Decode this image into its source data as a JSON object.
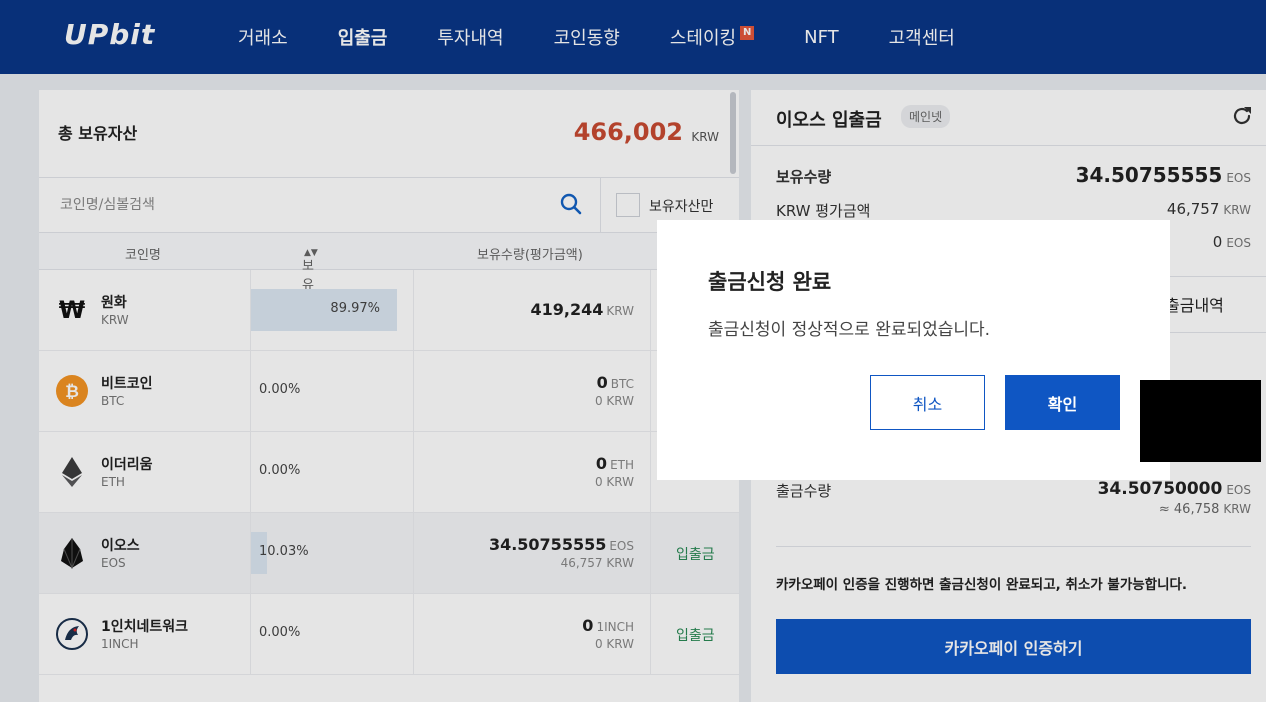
{
  "header": {
    "logo": "UPbit",
    "nav": [
      {
        "label": "거래소"
      },
      {
        "label": "입출금"
      },
      {
        "label": "투자내역"
      },
      {
        "label": "코인동향"
      },
      {
        "label": "스테이킹",
        "badge": "N"
      },
      {
        "label": "NFT"
      },
      {
        "label": "고객센터"
      }
    ],
    "active_nav": "입출금"
  },
  "assets": {
    "total_label": "총 보유자산",
    "total_value": "466,002",
    "total_unit": "KRW",
    "search_placeholder": "코인명/심볼검색",
    "own_only_label": "보유자산만",
    "columns": {
      "name": "코인명",
      "weight": "보유비중",
      "holding": "보유수량(평가금액)"
    },
    "rows": [
      {
        "name": "원화",
        "symbol": "KRW",
        "weight": "89.97%",
        "weight_fraction": 0.8997,
        "qty": "419,244",
        "qty_unit": "KRW",
        "krw": "",
        "krw_unit": "",
        "action": ""
      },
      {
        "name": "비트코인",
        "symbol": "BTC",
        "weight": "0.00%",
        "weight_fraction": 0,
        "qty": "0",
        "qty_unit": "BTC",
        "krw": "0",
        "krw_unit": "KRW",
        "action": ""
      },
      {
        "name": "이더리움",
        "symbol": "ETH",
        "weight": "0.00%",
        "weight_fraction": 0,
        "qty": "0",
        "qty_unit": "ETH",
        "krw": "0",
        "krw_unit": "KRW",
        "action": ""
      },
      {
        "name": "이오스",
        "symbol": "EOS",
        "weight": "10.03%",
        "weight_fraction": 0.1003,
        "qty": "34.50755555",
        "qty_unit": "EOS",
        "krw": "46,757",
        "krw_unit": "KRW",
        "action": "입출금"
      },
      {
        "name": "1인치네트워크",
        "symbol": "1INCH",
        "weight": "0.00%",
        "weight_fraction": 0,
        "qty": "0",
        "qty_unit": "1INCH",
        "krw": "0",
        "krw_unit": "KRW",
        "action": "입출금"
      }
    ]
  },
  "withdraw_panel": {
    "title": "이오스 입출금",
    "network_badge": "메인넷",
    "holding_label": "보유수량",
    "holding_value": "34.50755555",
    "holding_unit": "EOS",
    "krw_label": "KRW 평가금액",
    "krw_value": "46,757",
    "krw_unit": "KRW",
    "third_value": "0",
    "third_unit": "EOS",
    "history_tab": "출금내역",
    "amount_label": "출금수량",
    "amount_value": "34.50750000",
    "amount_unit": "EOS",
    "amount_krw": "≈ 46,758",
    "amount_krw_unit": "KRW",
    "notice": "카카오페이 인증을 진행하면 출금신청이 완료되고, 취소가 불가능합니다.",
    "kakao_button": "카카오페이 인증하기"
  },
  "modal": {
    "title": "출금신청 완료",
    "message": "출금신청이 정상적으로 완료되었습니다.",
    "cancel_label": "취소",
    "ok_label": "확인"
  },
  "colors": {
    "header_bg": "#093687",
    "primary_blue": "#0f56c3",
    "total_red": "#c84a31",
    "action_green": "#2a8a55"
  }
}
